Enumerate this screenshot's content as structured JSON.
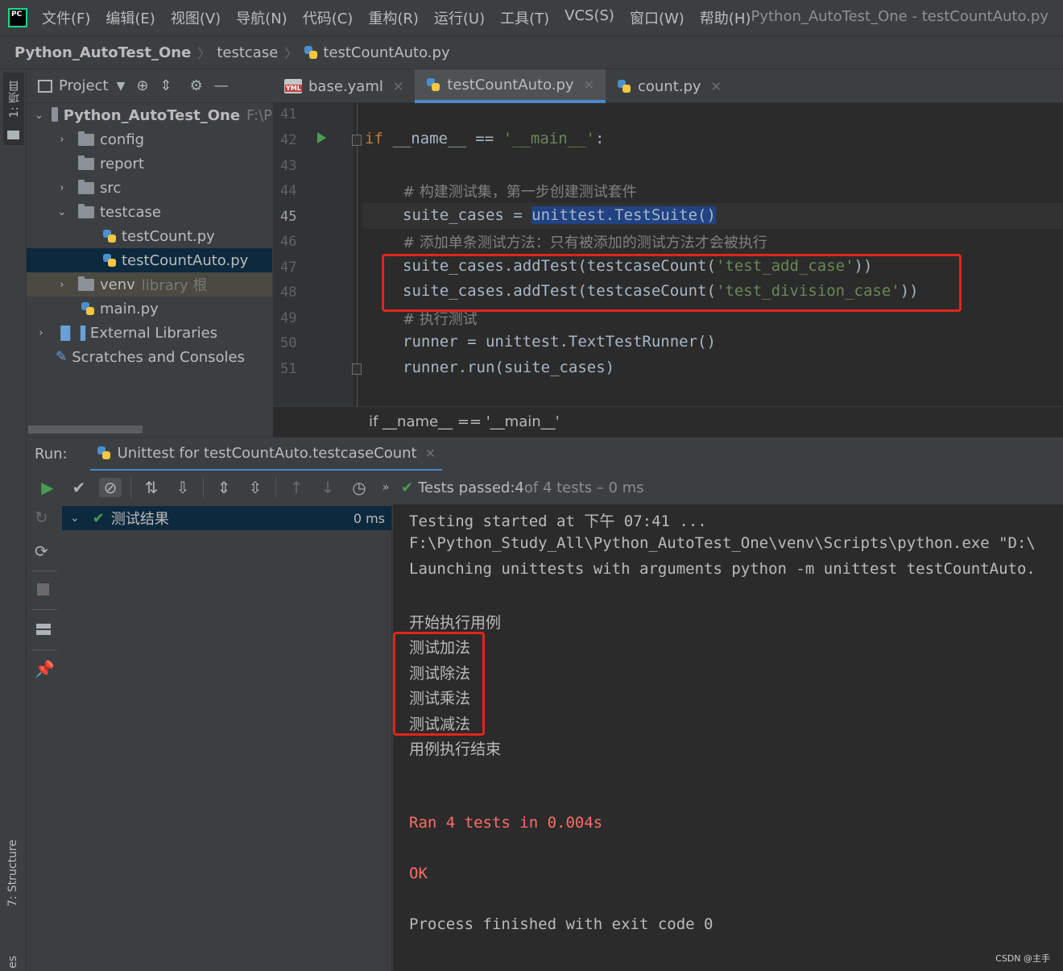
{
  "menubar": {
    "items": [
      "文件(F)",
      "编辑(E)",
      "视图(V)",
      "导航(N)",
      "代码(C)",
      "重构(R)",
      "运行(U)",
      "工具(T)",
      "VCS(S)",
      "窗口(W)",
      "帮助(H)"
    ],
    "window_title": "Python_AutoTest_One - testCountAuto.py",
    "logo_text": "PC"
  },
  "breadcrumb": [
    "Python_AutoTest_One",
    "testcase",
    "testCountAuto.py"
  ],
  "left_stripe": {
    "project": "1: 项目",
    "structure": "7: Structure",
    "bottom": "es"
  },
  "project_panel": {
    "title": "Project",
    "tree": [
      {
        "label": "Python_AutoTest_One",
        "extra": "F:\\P",
        "bold": true
      },
      {
        "label": "config"
      },
      {
        "label": "report"
      },
      {
        "label": "src"
      },
      {
        "label": "testcase"
      },
      {
        "label": "testCount.py"
      },
      {
        "label": "testCountAuto.py"
      },
      {
        "label": "venv",
        "extra": "library 根"
      },
      {
        "label": "main.py"
      },
      {
        "label": "External Libraries"
      },
      {
        "label": "Scratches and Consoles"
      }
    ]
  },
  "editor": {
    "tabs": [
      {
        "label": "base.yaml"
      },
      {
        "label": "testCountAuto.py",
        "active": true
      },
      {
        "label": "count.py"
      }
    ],
    "line_numbers": [
      "41",
      "42",
      "43",
      "44",
      "45",
      "46",
      "47",
      "48",
      "49",
      "50",
      "51"
    ],
    "current_line": "45",
    "lines": {
      "l42_kw": "if",
      "l42_rest": " __name__ == ",
      "l42_str": "'__main__'",
      "l42_end": ":",
      "l44_comment": "# 构建测试集，第一步创建测试套件",
      "l45_pre": "suite_cases = ",
      "l45_sel": "unittest.TestSuite()",
      "l46_comment": "# 添加单条测试方法：只有被添加的测试方法才会被执行",
      "l47_pre": "suite_cases.addTest(testcaseCount(",
      "l47_str": "'test_add_case'",
      "l47_end": "))",
      "l48_pre": "suite_cases.addTest(testcaseCount(",
      "l48_str": "'test_division_case'",
      "l48_end": "))",
      "l49_comment": "# 执行测试",
      "l50": "runner = unittest.TextTestRunner()",
      "l51": "runner.run(suite_cases)"
    },
    "breadcrumb": "if __name__ == '__main__'"
  },
  "run": {
    "label": "Run:",
    "tab_label": "Unittest for testCountAuto.testcaseCount",
    "status_prefix": "Tests passed: ",
    "status_passed": "4",
    "status_rest": " of 4 tests – 0 ms",
    "tree_root": "测试结果",
    "tree_root_time": "0 ms"
  },
  "console": {
    "lines": [
      "Testing started at 下午 07:41 ...",
      "F:\\Python_Study_All\\Python_AutoTest_One\\venv\\Scripts\\python.exe \"D:\\",
      "Launching unittests with arguments python -m unittest testCountAuto.",
      "开始执行用例",
      "测试加法",
      "测试除法",
      "测试乘法",
      "测试减法",
      "用例执行结束",
      "Ran 4 tests in 0.004s",
      "OK",
      "Process finished with exit code 0"
    ]
  },
  "watermark": "CSDN @主手"
}
